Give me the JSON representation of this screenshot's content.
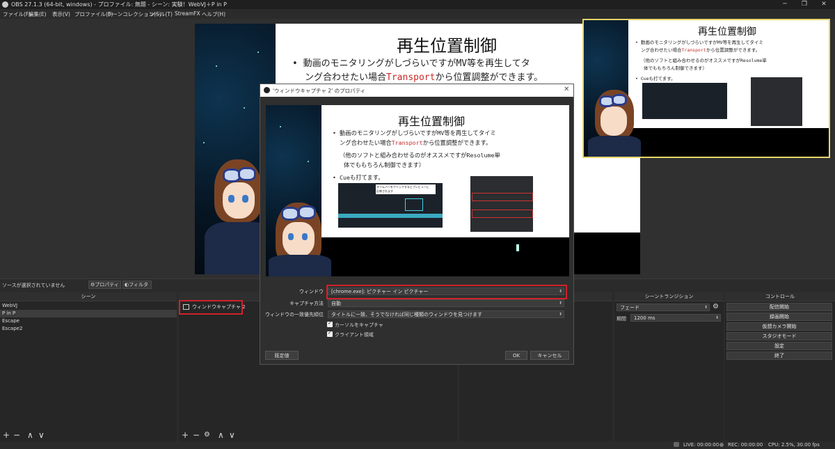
{
  "window": {
    "title": "OBS 27.1.3 (64-bit, windows) - プロファイル: 無題 - シーン: 実験！WebVJ＋P in P",
    "minimize": "─",
    "maximize": "❐",
    "close": "✕"
  },
  "menu": [
    "ファイル(F)",
    "編集(E)",
    "表示(V)",
    "プロファイル(P)",
    "シーンコレクション(S)",
    "ツール(T)",
    "StreamFX",
    "ヘルプ(H)"
  ],
  "slide": {
    "title": "再生位置制御",
    "bullet1_line1": "• 動画のモニタリングがしづらいですがMV等を再生してタイミ",
    "bullet1_line2_a": "ング合わせたい場合",
    "bullet1_line2_red": "Transport",
    "bullet1_line2_b": "から位置調整ができます。",
    "note_line1": "（他のソフトと組み合わせるのがオススメですがResolume単",
    "note_line2": "体でももちろん制御できます）",
    "bullet2": "• Cueも打てます。",
    "canvas_line1": "• 動画のモニタリングがしづらいですがMV等を再生してタ",
    "canvas_line2_a": "ング合わせたい場合",
    "canvas_line2_red": "Transport",
    "canvas_line2_b": "から位置調整ができます。",
    "screenshot_label1": "タイムバーをクリックするとプレビューに",
    "screenshot_label2": "反映されます"
  },
  "dialog": {
    "title": "'ウィンドウキャプチャ 2' のプロパティ",
    "close": "✕",
    "fields": [
      {
        "label": "ウィンドウ",
        "value": "[chrome.exe]: ピクチャー イン ピクチャー"
      },
      {
        "label": "キャプチャ方法",
        "value": "自動"
      },
      {
        "label": "ウィンドウの一致優先順位",
        "value": "タイトルに一致、そうでなければ同じ種類のウィンドウを見つけます"
      }
    ],
    "checkboxes": [
      "カーソルをキャプチャ",
      "クライアント領域"
    ],
    "defaults_button": "既定値",
    "ok_button": "OK",
    "cancel_button": "キャンセル"
  },
  "source_toolbar": {
    "no_source": "ソースが選択されていません",
    "properties": "プロパティ",
    "filters": "フィルタ"
  },
  "scenes": {
    "header": "シーン",
    "items": [
      "WebVJ",
      "P in P",
      "Escape",
      "Escape2"
    ],
    "selected_index": 1
  },
  "sources": {
    "items": [
      "ウィンドウキャプチャ 2"
    ]
  },
  "transitions": {
    "header": "シーントランジション",
    "type": "フェード",
    "duration_label": "期間",
    "duration_value": "1200 ms"
  },
  "controls": {
    "header": "コントロール",
    "buttons": [
      "配信開始",
      "録画開始",
      "仮想カメラ開始",
      "スタジオモード",
      "設定",
      "終了"
    ]
  },
  "status": {
    "live": "LIVE: 00:00:00",
    "rec": "REC: 00:00:00",
    "cpu": "CPU: 2.5%, 30.00 fps"
  },
  "list_tools": {
    "add": "+",
    "remove": "−",
    "up": "∧",
    "down": "∨",
    "gear": "⚙"
  },
  "colors": {
    "highlight_red": "#d0222c",
    "pip_border": "#e7d56a",
    "transport_red": "#c62a2a"
  }
}
